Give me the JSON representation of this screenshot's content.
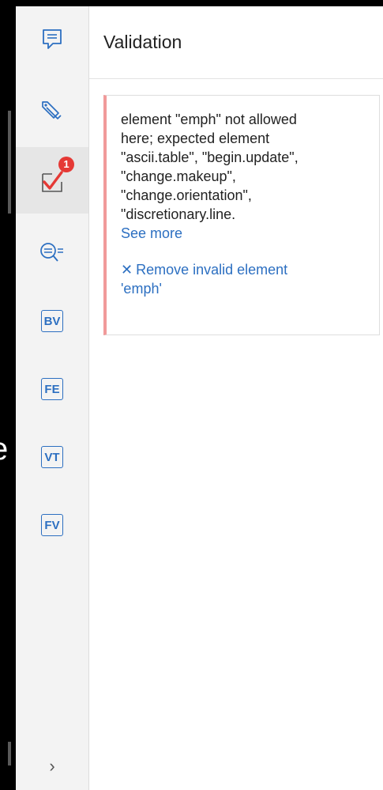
{
  "panel": {
    "title": "Validation"
  },
  "background": {
    "edge_glyph": "e"
  },
  "rail": {
    "items": [
      {
        "icon": "comment-icon"
      },
      {
        "icon": "tag-icon"
      },
      {
        "icon": "validation-check-icon",
        "badge": "1",
        "active": true
      },
      {
        "icon": "search-list-icon"
      },
      {
        "abbr": "BV"
      },
      {
        "abbr": "FE"
      },
      {
        "abbr": "VT"
      },
      {
        "abbr": "FV"
      }
    ],
    "expand_glyph": "›"
  },
  "validation": {
    "message": "element \"emph\" not allowed\nhere; expected element\n\"ascii.table\", \"begin.update\",\n\"change.makeup\",\n\"change.orientation\",\n\"discretionary.line.",
    "see_more": "See more",
    "fix_icon": "✕",
    "fix_label": "Remove invalid element\n'emph'"
  },
  "colors": {
    "accent": "#2c6fc1",
    "error_border": "#f19a9a",
    "badge": "#e53935",
    "check_red": "#e53935"
  }
}
